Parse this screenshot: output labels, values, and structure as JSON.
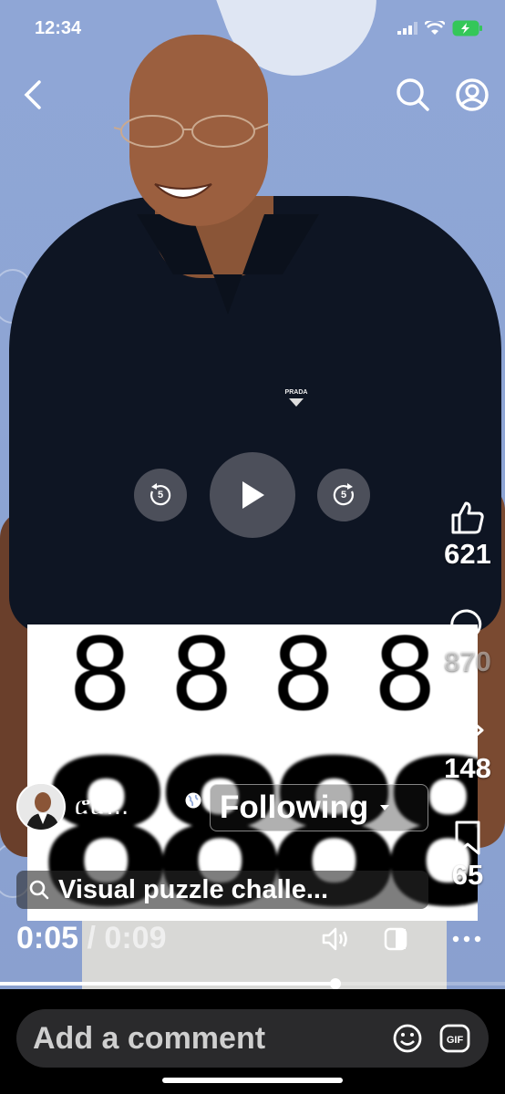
{
  "status_bar": {
    "time": "12:34"
  },
  "puzzle": {
    "digits_top": [
      "8",
      "8",
      "8",
      "8"
    ],
    "digits_bottom": "8888"
  },
  "shirt_logo": "PRADA",
  "controls": {
    "rewind_seconds": "5",
    "forward_seconds": "5"
  },
  "actions": {
    "like_count": "621",
    "comment_count": "870",
    "share_count": "148",
    "save_count": "65"
  },
  "author": {
    "name": "ሮሮ...",
    "follow_label": "Following"
  },
  "search": {
    "text": "Visual puzzle challe..."
  },
  "playback": {
    "current": "0:05",
    "separator": "/",
    "total": "0:09",
    "progress": 0.665
  },
  "comment": {
    "placeholder": "Add a comment"
  },
  "icons": {
    "back": "chevron-left-icon",
    "search": "search-icon",
    "profile": "profile-icon",
    "like": "thumbs-up-icon",
    "comment": "comment-bubble-icon",
    "share": "share-arrow-icon",
    "save": "bookmark-icon",
    "volume": "speaker-icon",
    "caption": "caption-toggle-icon",
    "more": "more-dots-icon",
    "emoji": "emoji-icon",
    "gif": "gif-icon"
  }
}
